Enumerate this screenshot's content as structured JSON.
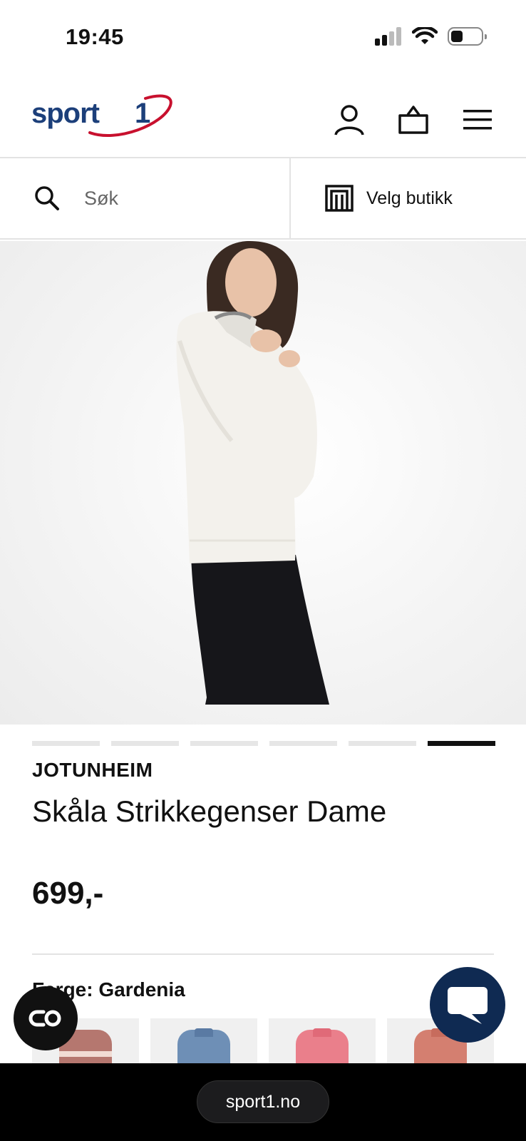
{
  "status_bar": {
    "time": "19:45"
  },
  "header": {
    "logo_text": "sport",
    "logo_number": "1"
  },
  "search": {
    "placeholder": "Søk"
  },
  "store": {
    "label": "Velg butikk"
  },
  "carousel": {
    "total": 6,
    "active_index": 5
  },
  "product": {
    "brand": "JOTUNHEIM",
    "name": "Skåla Strikkegenser Dame",
    "price": "699,-",
    "color_label": "Farge: Gardenia"
  },
  "swatches": [
    {
      "color": "#b5776f",
      "accent": "#f1dcd4"
    },
    {
      "color": "#6e8fb6",
      "accent": "#5a7aa3"
    },
    {
      "color": "#ea7f8b",
      "accent": "#e06a78"
    },
    {
      "color": "#d47f70",
      "accent": "#c76c5d"
    }
  ],
  "browser": {
    "url": "sport1.no"
  },
  "colors": {
    "brand_blue": "#1c3f7a",
    "brand_red": "#c8102e",
    "chat_navy": "#0f2a52"
  }
}
